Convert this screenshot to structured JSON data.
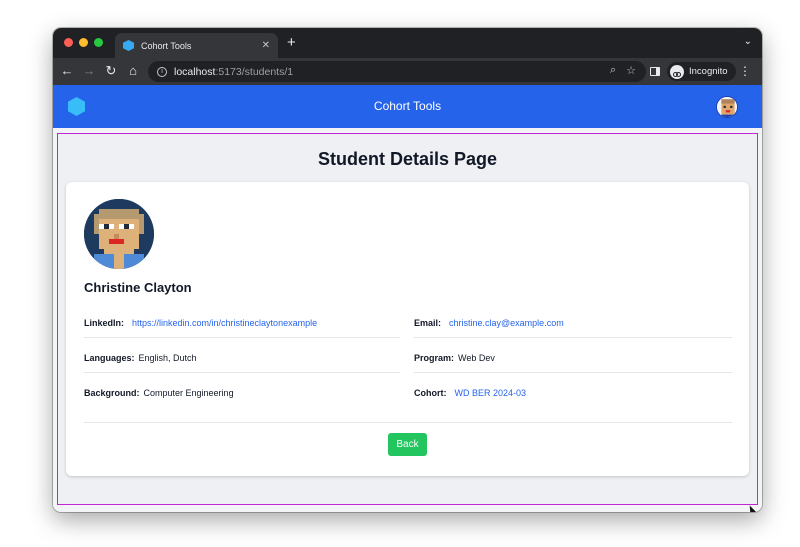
{
  "browser": {
    "tab_title": "Cohort Tools",
    "url_host": "localhost",
    "url_path": ":5173/students/1",
    "incognito_label": "Incognito"
  },
  "app": {
    "title": "Cohort Tools"
  },
  "page": {
    "heading": "Student Details Page"
  },
  "student": {
    "name": "Christine Clayton",
    "fields": {
      "linkedin_label": "LinkedIn:",
      "linkedin_value": "https://linkedin.com/in/christineclaytonexample",
      "email_label": "Email:",
      "email_value": "christine.clay@example.com",
      "languages_label": "Languages:",
      "languages_value": "English, Dutch",
      "program_label": "Program:",
      "program_value": "Web Dev",
      "background_label": "Background:",
      "background_value": "Computer Engineering",
      "cohort_label": "Cohort:",
      "cohort_value": "WD BER 2024-03"
    }
  },
  "actions": {
    "back_label": "Back"
  },
  "colors": {
    "brand_blue": "#2563eb",
    "back_green": "#22c55e",
    "frame_magenta": "#c026d3"
  },
  "icons": {
    "favicon": "hexagon-logo-icon",
    "app_logo": "hexagon-logo-icon",
    "avatar": "pixel-avatar-icon"
  }
}
